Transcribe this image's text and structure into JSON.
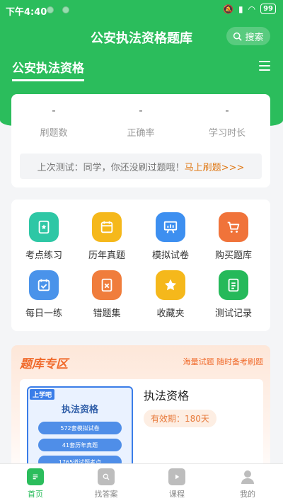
{
  "status_bar": {
    "time": "下午4:40",
    "battery": "99"
  },
  "header": {
    "title": "公安执法资格题库",
    "search_label": "搜索",
    "category": "公安执法资格"
  },
  "stats": {
    "items": [
      {
        "value": "-",
        "label": "刷题数"
      },
      {
        "value": "-",
        "label": "正确率"
      },
      {
        "value": "-",
        "label": "学习时长"
      }
    ],
    "last_test_prefix": "上次测试：同学，你还没刷过题哦！",
    "last_test_link": "马上刷题>>>"
  },
  "grid": [
    {
      "label": "考点练习",
      "icon": "star-doc-icon",
      "color": "#2ec7a5"
    },
    {
      "label": "历年真题",
      "icon": "calendar-doc-icon",
      "color": "#f5b81b"
    },
    {
      "label": "模拟试卷",
      "icon": "board-chart-icon",
      "color": "#3d8ff0"
    },
    {
      "label": "购买题库",
      "icon": "cart-icon",
      "color": "#f0733a"
    },
    {
      "label": "每日一练",
      "icon": "calendar-check-icon",
      "color": "#4a93ea"
    },
    {
      "label": "错题集",
      "icon": "wrong-doc-icon",
      "color": "#f07d3c"
    },
    {
      "label": "收藏夹",
      "icon": "star-icon",
      "color": "#f5b81b"
    },
    {
      "label": "测试记录",
      "icon": "record-doc-icon",
      "color": "#25b95a"
    }
  ],
  "zone": {
    "title": "题库专区",
    "subtitle": "海量试题 随时备考刷题",
    "cover": {
      "badge": "上学吧",
      "title": "执法资格",
      "pills": [
        "572套模拟试卷",
        "41套历年真题",
        "1765道试题考点"
      ]
    },
    "product_title": "执法资格",
    "validity": "有效期：180天"
  },
  "tabbar": [
    {
      "label": "首页",
      "active": true
    },
    {
      "label": "找答案",
      "active": false
    },
    {
      "label": "课程",
      "active": false
    },
    {
      "label": "我的",
      "active": false
    }
  ],
  "colors": {
    "primary": "#2bbd5c",
    "accent": "#e07b1a"
  }
}
